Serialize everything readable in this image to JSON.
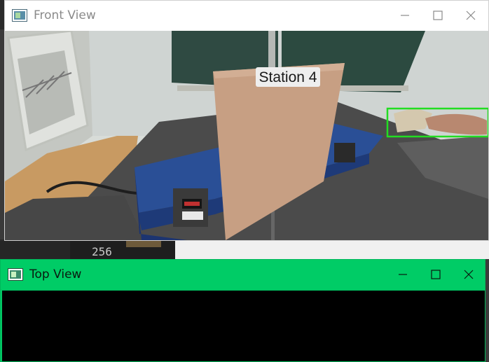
{
  "front_window": {
    "title": "Front View",
    "sign_text": "Station 4",
    "controls": [
      "minimize",
      "maximize",
      "close"
    ],
    "detection_color": "#22dd22"
  },
  "top_window": {
    "title": "Top View",
    "controls": [
      "minimize",
      "maximize",
      "close"
    ],
    "accent": "#00cc66"
  },
  "background": {
    "number_fragment": "256"
  }
}
